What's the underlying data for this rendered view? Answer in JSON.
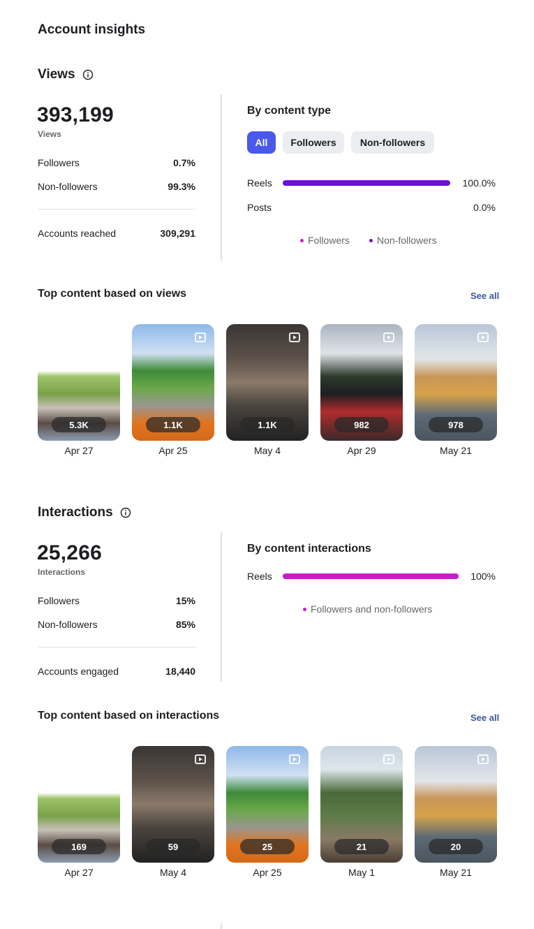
{
  "page_title": "Account insights",
  "views": {
    "title": "Views",
    "total": "393,199",
    "total_label": "Views",
    "followers_label": "Followers",
    "followers_value": "0.7%",
    "nonfollowers_label": "Non-followers",
    "nonfollowers_value": "99.3%",
    "reached_label": "Accounts reached",
    "reached_value": "309,291",
    "by_type_title": "By content type",
    "filters": [
      "All",
      "Followers",
      "Non-followers"
    ],
    "rows": [
      {
        "label": "Reels",
        "value": "100.0%",
        "fraction": 1.0
      },
      {
        "label": "Posts",
        "value": "0.0%",
        "fraction": 0.0
      }
    ],
    "legend": [
      "Followers",
      "Non-followers"
    ]
  },
  "top_views": {
    "title": "Top content based on views",
    "see_all": "See all",
    "items": [
      {
        "count": "5.3K",
        "date": "Apr 27"
      },
      {
        "count": "1.1K",
        "date": "Apr 25"
      },
      {
        "count": "1.1K",
        "date": "May 4"
      },
      {
        "count": "982",
        "date": "Apr 29"
      },
      {
        "count": "978",
        "date": "May 21"
      }
    ]
  },
  "interactions": {
    "title": "Interactions",
    "total": "25,266",
    "total_label": "Interactions",
    "followers_label": "Followers",
    "followers_value": "15%",
    "nonfollowers_label": "Non-followers",
    "nonfollowers_value": "85%",
    "engaged_label": "Accounts engaged",
    "engaged_value": "18,440",
    "by_title": "By content interactions",
    "row": {
      "label": "Reels",
      "value": "100%",
      "fraction": 1.0
    },
    "legend": "Followers and non-followers"
  },
  "top_interactions": {
    "title": "Top content based on interactions",
    "see_all": "See all",
    "items": [
      {
        "count": "169",
        "date": "Apr 27"
      },
      {
        "count": "59",
        "date": "May 4"
      },
      {
        "count": "25",
        "date": "Apr 25"
      },
      {
        "count": "21",
        "date": "May 1"
      },
      {
        "count": "20",
        "date": "May 21"
      }
    ]
  },
  "colors": {
    "accent": "#4a59ea",
    "views_bar": "#6a0fdc",
    "interactions_bar": "#c81ccc",
    "link": "#385898"
  }
}
